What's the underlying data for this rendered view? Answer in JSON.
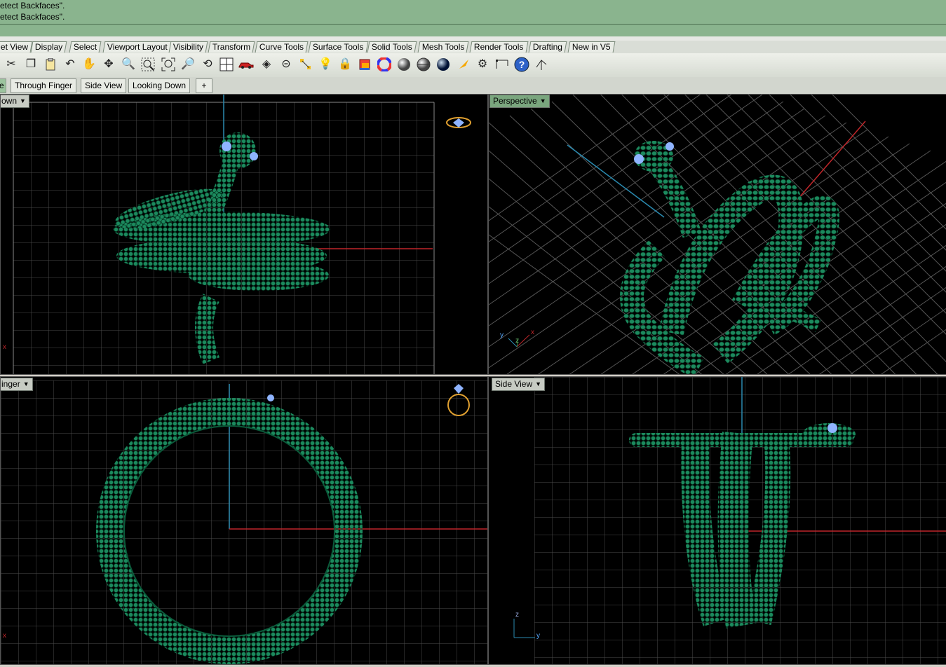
{
  "command_history": [
    "etect Backfaces\".",
    "etect Backfaces\"."
  ],
  "toolbar_tabs": [
    "et View",
    "Display",
    "Select",
    "Viewport Layout",
    "Visibility",
    "Transform",
    "Curve Tools",
    "Surface Tools",
    "Solid Tools",
    "Mesh Tools",
    "Render Tools",
    "Drafting",
    "New in V5"
  ],
  "toolbar_icons": [
    "cut-icon",
    "copy-icon",
    "paste-icon",
    "undo-icon",
    "pan-hand-icon",
    "rotate-view-icon",
    "zoom-icon",
    "zoom-window-icon",
    "zoom-extents-icon",
    "zoom-selected-icon",
    "undo-view-icon",
    "four-viewports-icon",
    "car-icon",
    "eye-icon",
    "circle-icon",
    "points-icon",
    "lightbulb-icon",
    "lock-icon",
    "layer-icon",
    "color-wheel-icon",
    "shaded-sphere-icon",
    "rendered-sphere-icon",
    "blue-sphere-icon",
    "mark-icon",
    "gear-icon",
    "dimension-icon",
    "help-icon",
    "arrow-icon"
  ],
  "viewport_tabs": [
    "e",
    "Through Finger",
    "Side View",
    "Looking Down",
    "+"
  ],
  "viewports": {
    "top_left": {
      "label": "own"
    },
    "top_right": {
      "label": "Perspective"
    },
    "bottom_left": {
      "label": "inger"
    },
    "bottom_right": {
      "label": "Side View"
    }
  },
  "axis_labels": {
    "x": "x",
    "y": "y",
    "z": "z"
  },
  "colors": {
    "model": "#117a52",
    "model_hi": "#2fb07a",
    "gem": "#8fb4ff",
    "grid": "#5a5a5a",
    "x_axis": "#c0262a",
    "y_axis": "#2a8ab0"
  }
}
